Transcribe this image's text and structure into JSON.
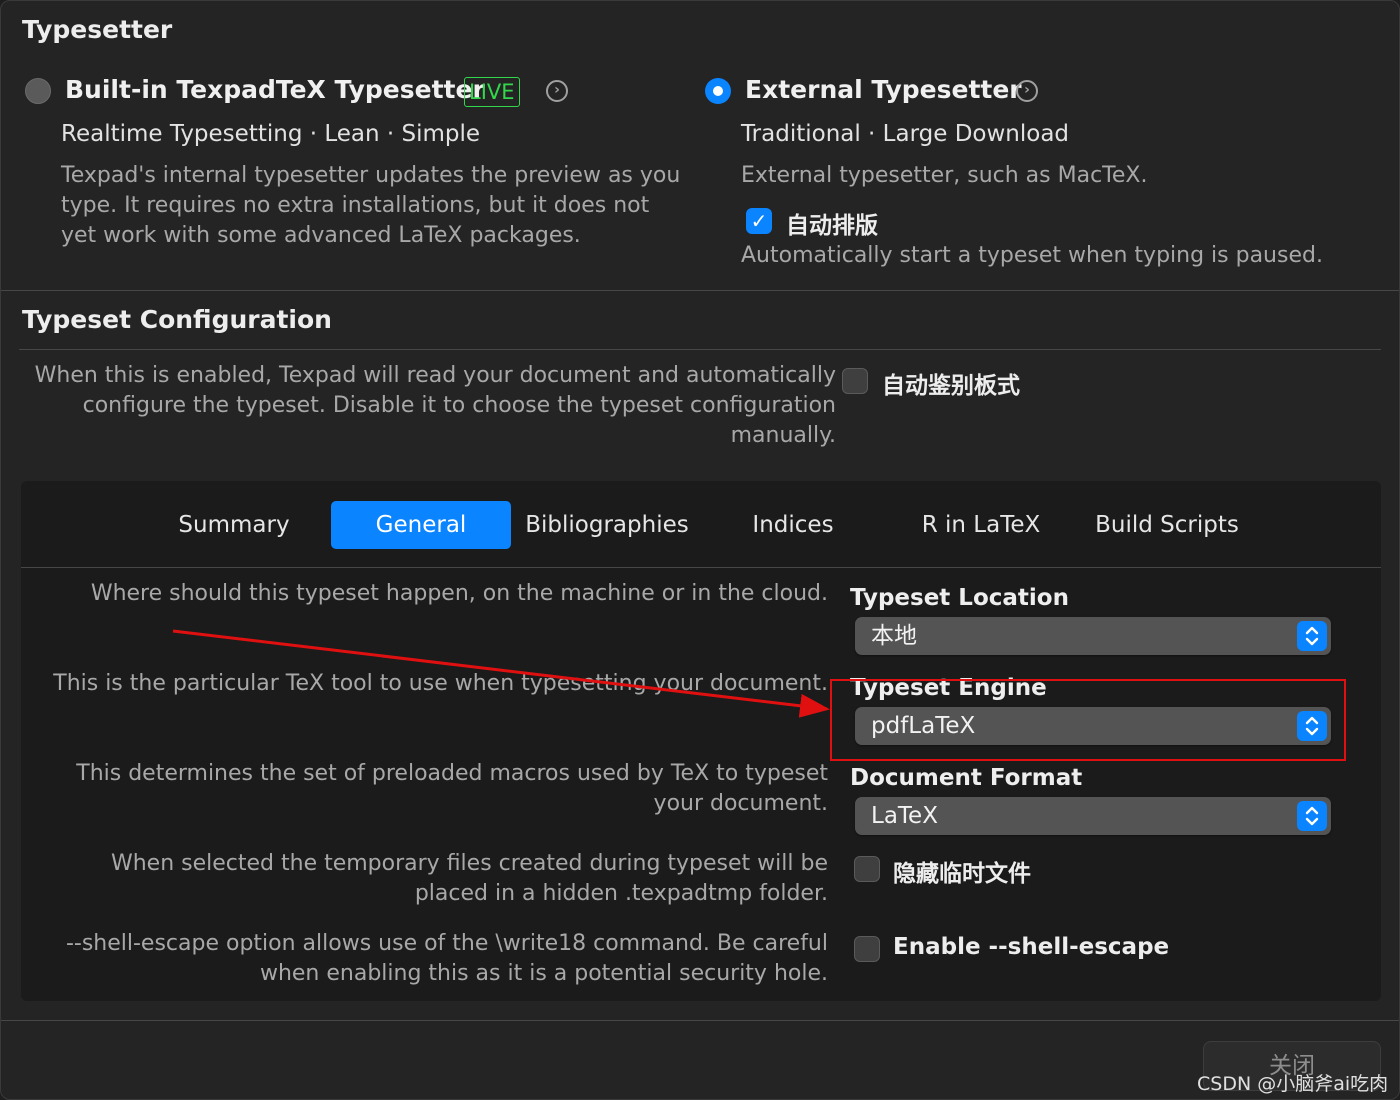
{
  "typesetter": {
    "title": "Typesetter",
    "builtin": {
      "label": "Built-in TexpadTeX Typesetter",
      "badge": "LIVE",
      "tagline": "Realtime Typesetting · Lean · Simple",
      "description": "Texpad's internal typesetter updates the preview as you type. It requires no extra installations, but it does not yet work with some advanced LaTeX packages.",
      "selected": false
    },
    "external": {
      "label": "External Typesetter",
      "tagline": "Traditional · Large Download",
      "description": "External typesetter, such as MacTeX.",
      "auto_typeset_label": "自动排版",
      "auto_typeset_checked": true,
      "auto_typeset_description": "Automatically start a typeset when typing is paused.",
      "selected": true
    }
  },
  "config": {
    "title": "Typeset Configuration",
    "auto_detect_description": "When this is enabled, Texpad will read your document and automatically configure the typeset. Disable it to choose the typeset configuration manually.",
    "auto_detect_label": "自动鉴别板式",
    "auto_detect_checked": false
  },
  "tabs": [
    {
      "label": "Summary",
      "active": false
    },
    {
      "label": "General",
      "active": true
    },
    {
      "label": "Bibliographies",
      "active": false
    },
    {
      "label": "Indices",
      "active": false
    },
    {
      "label": "R in LaTeX",
      "active": false
    },
    {
      "label": "Build Scripts",
      "active": false
    }
  ],
  "general": {
    "location": {
      "description": "Where should this typeset happen, on the machine or in the cloud.",
      "label": "Typeset Location",
      "value": "本地"
    },
    "engine": {
      "description": "This is the particular TeX tool to use when typesetting your document.",
      "label": "Typeset Engine",
      "value": "pdfLaTeX"
    },
    "format": {
      "description": "This determines the set of preloaded macros used by TeX to typeset your document.",
      "label": "Document Format",
      "value": "LaTeX"
    },
    "hide_temp": {
      "description": "When selected the temporary files created during typeset will be placed in a hidden .texpadtmp folder.",
      "label": "隐藏临时文件",
      "checked": false
    },
    "shell_escape": {
      "description": "--shell-escape option allows use of the \\write18 command. Be careful when enabling this as it is a potential security hole.",
      "label": "Enable --shell-escape",
      "checked": false
    }
  },
  "footer": {
    "close_label": "关闭",
    "watermark": "CSDN @小脑斧ai吃肉"
  },
  "colors": {
    "accent": "#0a84ff",
    "live_green": "#32d74b",
    "annotation_red": "#e01010"
  }
}
